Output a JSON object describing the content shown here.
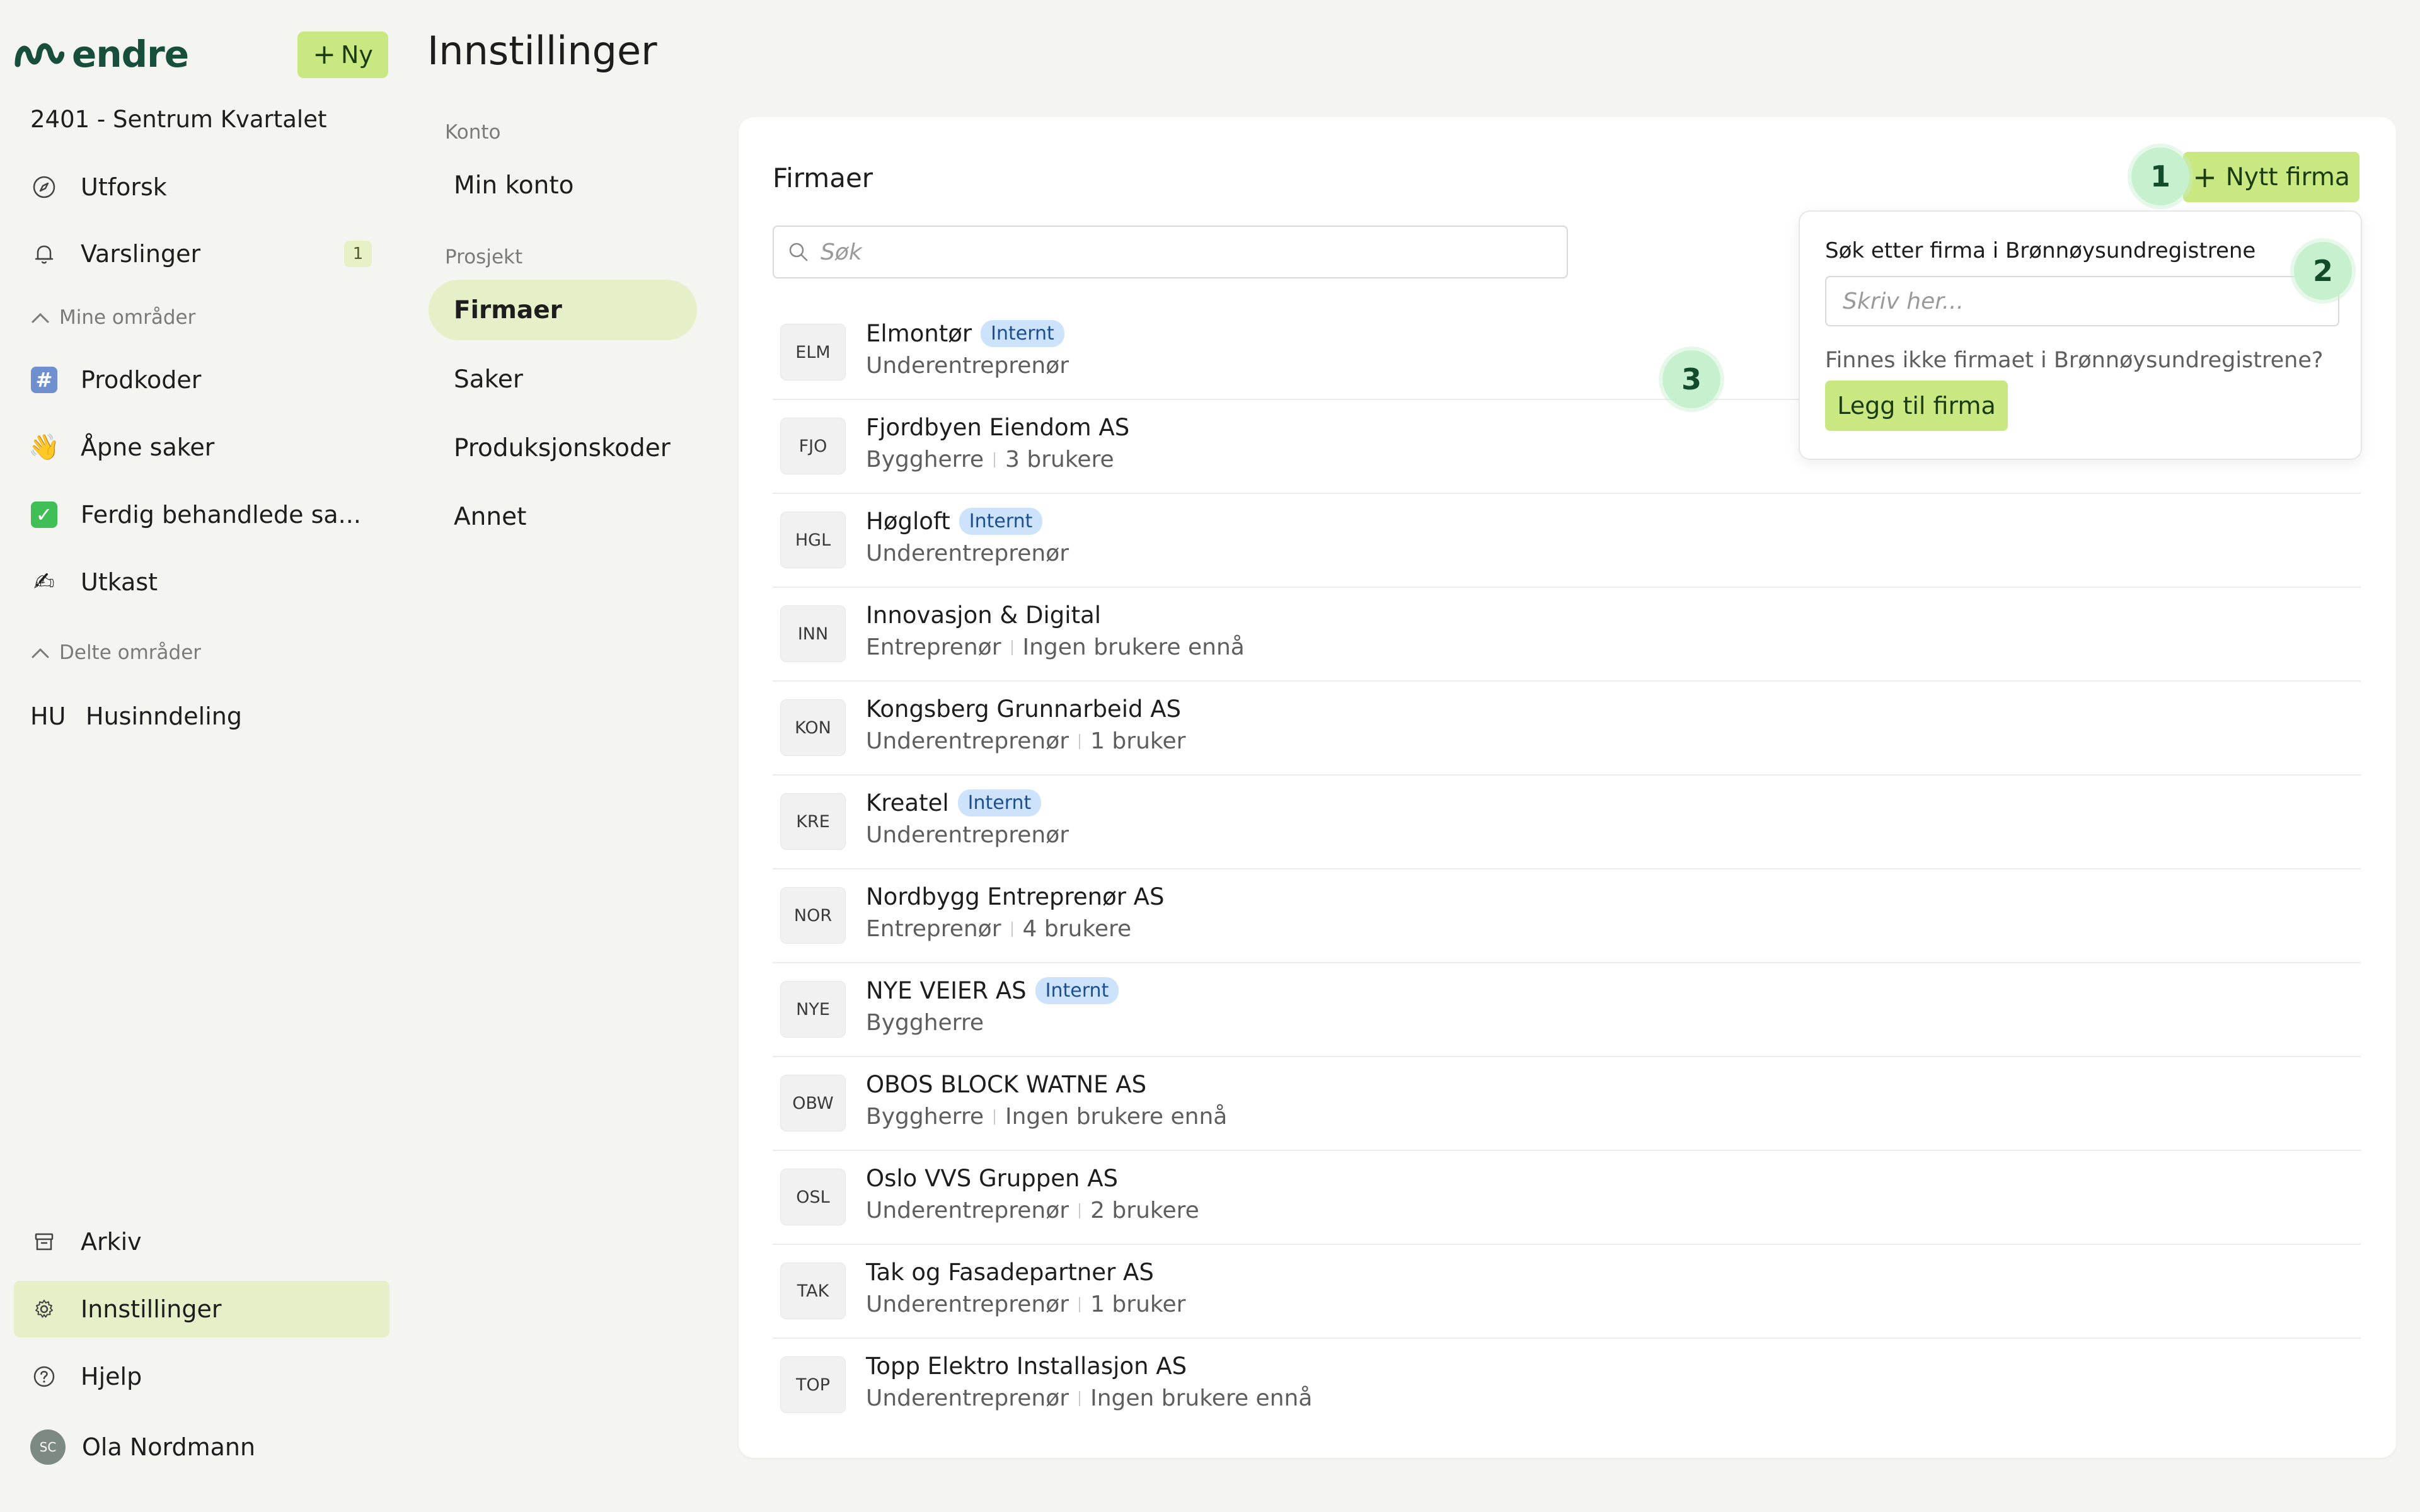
{
  "app": {
    "logo_text": "endre",
    "new_button": "Ny",
    "project_name": "2401 - Sentrum Kvartalet"
  },
  "sidebar": {
    "top_items": [
      {
        "label": "Utforsk",
        "icon": "compass-icon"
      },
      {
        "label": "Varslinger",
        "icon": "bell-icon",
        "badge": "1"
      }
    ],
    "my_areas_label": "Mine områder",
    "my_areas": [
      {
        "label": "Prodkoder",
        "icon": "hash-icon"
      },
      {
        "label": "Åpne saker",
        "icon": "waving-hand-icon"
      },
      {
        "label": "Ferdig behandlede sa...",
        "icon": "check-mark-icon"
      },
      {
        "label": "Utkast",
        "icon": "writing-hand-icon"
      }
    ],
    "shared_areas_label": "Delte områder",
    "shared_areas": [
      {
        "abbr": "HU",
        "label": "Husinndeling"
      }
    ],
    "bottom_items": [
      {
        "label": "Arkiv",
        "icon": "archive-icon"
      },
      {
        "label": "Innstillinger",
        "icon": "gear-icon",
        "active": true
      },
      {
        "label": "Hjelp",
        "icon": "help-circle-icon"
      }
    ],
    "user": {
      "initials": "SC",
      "name": "Ola Nordmann"
    }
  },
  "page": {
    "title": "Innstillinger"
  },
  "settings_nav": {
    "groups": [
      {
        "label": "Konto",
        "items": [
          "Min konto"
        ]
      },
      {
        "label": "Prosjekt",
        "items": [
          "Firmaer",
          "Saker",
          "Produksjonskoder",
          "Annet"
        ]
      }
    ],
    "active": "Firmaer"
  },
  "companies_panel": {
    "title": "Firmaer",
    "search_placeholder": "Søk",
    "new_company_button": "Nytt firma",
    "companies": [
      {
        "abbr": "ELM",
        "name": "Elmontør",
        "tag": "Internt",
        "role": "Underentreprenør",
        "users": ""
      },
      {
        "abbr": "FJO",
        "name": "Fjordbyen Eiendom AS",
        "tag": "",
        "role": "Byggherre",
        "users": "3 brukere"
      },
      {
        "abbr": "HGL",
        "name": "Høgloft",
        "tag": "Internt",
        "role": "Underentreprenør",
        "users": ""
      },
      {
        "abbr": "INN",
        "name": "Innovasjon & Digital",
        "tag": "",
        "role": "Entreprenør",
        "users": "Ingen brukere ennå"
      },
      {
        "abbr": "KON",
        "name": "Kongsberg Grunnarbeid AS",
        "tag": "",
        "role": "Underentreprenør",
        "users": "1 bruker"
      },
      {
        "abbr": "KRE",
        "name": "Kreatel",
        "tag": "Internt",
        "role": "Underentreprenør",
        "users": ""
      },
      {
        "abbr": "NOR",
        "name": "Nordbygg Entreprenør AS",
        "tag": "",
        "role": "Entreprenør",
        "users": "4 brukere"
      },
      {
        "abbr": "NYE",
        "name": "NYE VEIER AS",
        "tag": "Internt",
        "role": "Byggherre",
        "users": ""
      },
      {
        "abbr": "OBW",
        "name": "OBOS BLOCK WATNE AS",
        "tag": "",
        "role": "Byggherre",
        "users": "Ingen brukere ennå"
      },
      {
        "abbr": "OSL",
        "name": "Oslo VVS Gruppen AS",
        "tag": "",
        "role": "Underentreprenør",
        "users": "2 brukere"
      },
      {
        "abbr": "TAK",
        "name": "Tak og Fasadepartner AS",
        "tag": "",
        "role": "Underentreprenør",
        "users": "1 bruker"
      },
      {
        "abbr": "TOP",
        "name": "Topp Elektro Installasjon AS",
        "tag": "",
        "role": "Underentreprenør",
        "users": "Ingen brukere ennå"
      }
    ]
  },
  "brreg": {
    "label": "Søk etter firma i Brønnøysundregistrene",
    "placeholder": "Skriv her...",
    "question": "Finnes ikke firmaet i Brønnøysundregistrene?",
    "add_button": "Legg til firma"
  },
  "steps": [
    "1",
    "2",
    "3"
  ],
  "colors": {
    "accent": "#c9e882",
    "active_bg": "#e6f0c8",
    "tag_bg": "#cde3fb",
    "step_bg": "#c7f0cf",
    "brand": "#174f3c"
  }
}
